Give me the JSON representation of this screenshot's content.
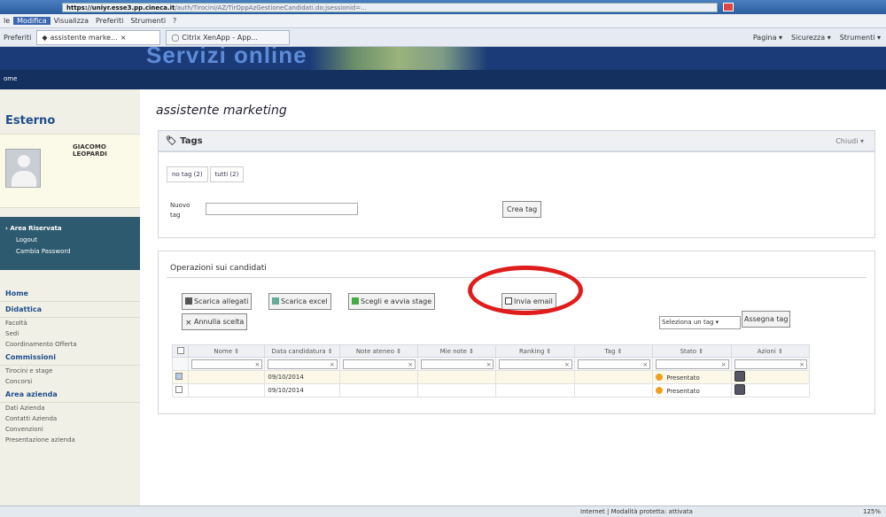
{
  "browser": {
    "url_host": "https://uniyr.esse3.pp.cineca.it",
    "url_rest": "/auth/Tirocini/AZ/TirOppAzGestioneCandidati.do;jsessionid=...",
    "menu": [
      "le",
      "Modifica",
      "Visualizza",
      "Preferiti",
      "Strumenti",
      "?"
    ],
    "favorites_label": "Preferiti",
    "tabs": [
      "assistente marke...",
      "Citrix XenApp - App..."
    ],
    "tools": [
      "Pagina ▾",
      "Sicurezza ▾",
      "Strumenti ▾"
    ]
  },
  "banner": {
    "title": "Servizi online"
  },
  "nav": {
    "home": "ome"
  },
  "sidebar": {
    "section": "Esterno",
    "user_name": "GIACOMO LEOPARDI",
    "area": {
      "title": "Area Riservata",
      "links": [
        "Logout",
        "Cambia Password"
      ]
    },
    "groups": [
      {
        "heading": "Home",
        "items": []
      },
      {
        "heading": "Didattica",
        "items": [
          "Facoltà",
          "Sedi",
          "Coordinamento Offerta"
        ]
      },
      {
        "heading": "Commissioni",
        "items": [
          "Tirocini e stage",
          "Concorsi"
        ]
      },
      {
        "heading": "Area azienda",
        "items": [
          "Dati Azienda",
          "Contatti Azienda",
          "Convenzioni",
          "Presentazione azienda"
        ]
      }
    ]
  },
  "main": {
    "page_title": "assistente marketing",
    "tags": {
      "title": "Tags",
      "close": "Chiudi",
      "filters": [
        "no tag (2)",
        "tutti (2)"
      ],
      "new_tag_label": "Nuovo tag",
      "new_tag_value": "",
      "create_button": "Crea tag"
    },
    "operations": {
      "title": "Operazioni sui candidati",
      "buttons": [
        "Scarica allegati",
        "Scarica excel",
        "Scegli e avvia stage",
        "Invia email",
        "Annulla scelta"
      ],
      "select_tag": "Seleziona un tag",
      "assign_tag": "Assegna tag"
    },
    "table": {
      "columns": [
        "",
        "Nome ⇕",
        "Data candidatura ⇕",
        "Note ateneo ⇕",
        "Mie note ⇕",
        "Ranking ⇕",
        "Tag ⇕",
        "Stato ⇕",
        "Azioni ⇕"
      ],
      "clear_x": "×",
      "rows": [
        {
          "checked": true,
          "nome": "",
          "data": "09/10/2014",
          "note_ateneo": "",
          "mie_note": "",
          "ranking": "",
          "tag": "",
          "stato": "Presentato"
        },
        {
          "checked": false,
          "nome": "",
          "data": "09/10/2014",
          "note_ateneo": "",
          "mie_note": "",
          "ranking": "",
          "tag": "",
          "stato": "Presentato"
        }
      ]
    }
  },
  "statusbar": {
    "zone": "Internet | Modalità protetta: attivata",
    "zoom": "125%"
  },
  "colors": {
    "banner": "#1b3b78",
    "sidebar_area": "#2d5a6e",
    "highlight": "#e01c1c"
  }
}
